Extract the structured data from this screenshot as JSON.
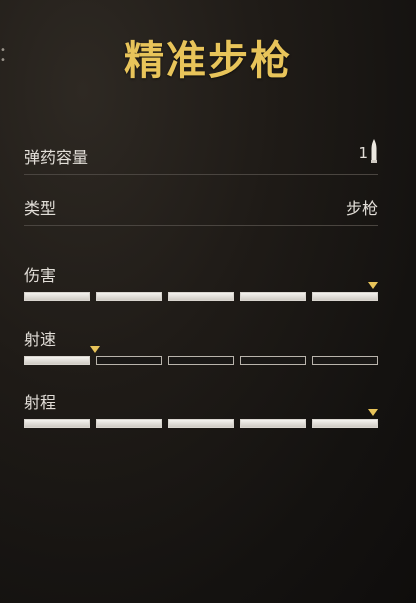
{
  "title": "精准步枪",
  "info": {
    "ammo_label": "弹药容量",
    "ammo_value": "1",
    "ammo_icon": "bullet-icon",
    "type_label": "类型",
    "type_value": "步枪"
  },
  "stats": [
    {
      "label": "伤害",
      "segments_total": 5,
      "segments_filled": 5,
      "marker_level": 1.0
    },
    {
      "label": "射速",
      "segments_total": 5,
      "segments_filled": 1,
      "marker_level": 0.2
    },
    {
      "label": "射程",
      "segments_total": 5,
      "segments_filled": 5,
      "marker_level": 1.0
    }
  ],
  "colors": {
    "title": "#e8c45a",
    "marker": "#e8c45a",
    "bar_filled": "#e6e3de",
    "bar_empty_border": "#b9b4ac",
    "divider": "#4a4540"
  }
}
